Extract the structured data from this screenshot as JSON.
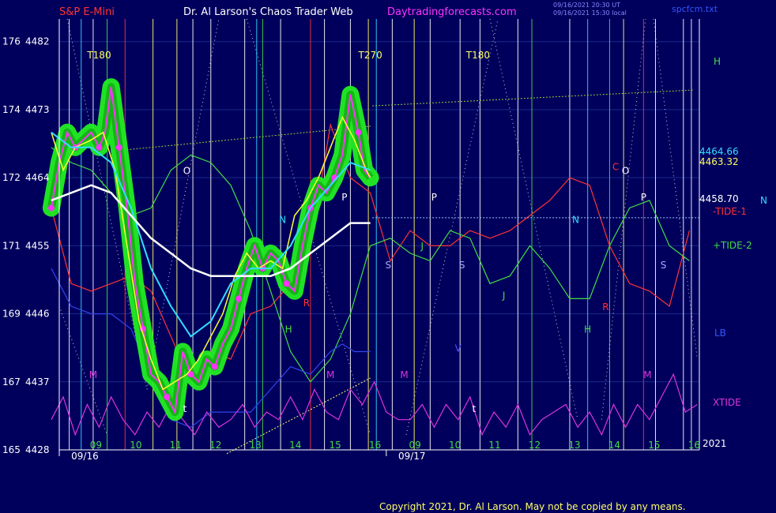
{
  "header": {
    "instrument": "S&P E-Mini",
    "title": "Dr. Al Larson's Chaos Trader Web",
    "site": "Daytradingforecasts.com",
    "stamp1": "09/16/2021 20:30 UT",
    "stamp2": "09/16/2021 15:30 local",
    "file": "spcfcm.txt",
    "copyright": "Copyright 2021, Dr. Al Larson. May not be copied by any means."
  },
  "colors": {
    "background": "#00005c",
    "price_bar": "#ff33ff",
    "price_glow": "#22ee22",
    "fast_ma": "#ffff33",
    "mid_ma": "#33ddff",
    "slow_ma": "#ffffff",
    "tide1": "#ff3333",
    "tide2": "#44dd44",
    "xtide": "#dd33dd",
    "lb": "#3344ee",
    "helio": "#ffcc44"
  },
  "chart_data": {
    "type": "line",
    "title": "S&P E-Mini",
    "ylabel_left_pairs": [
      {
        "a": "176",
        "b": "4482"
      },
      {
        "a": "174",
        "b": "4473"
      },
      {
        "a": "172",
        "b": "4464"
      },
      {
        "a": "171",
        "b": "4455"
      },
      {
        "a": "169",
        "b": "4446"
      },
      {
        "a": "167",
        "b": "4437"
      },
      {
        "a": "165",
        "b": "4428"
      }
    ],
    "ylim": [
      4428,
      4485
    ],
    "xlim": [
      8.2,
      24.25
    ],
    "x_hour_labels": [
      {
        "x": 9,
        "label": "09"
      },
      {
        "x": 10,
        "label": "10"
      },
      {
        "x": 11,
        "label": "11"
      },
      {
        "x": 12,
        "label": "12"
      },
      {
        "x": 13,
        "label": "13"
      },
      {
        "x": 14,
        "label": "14"
      },
      {
        "x": 15,
        "label": "15"
      },
      {
        "x": 16,
        "label": "16"
      },
      {
        "x": 17,
        "label": "09"
      },
      {
        "x": 18,
        "label": "10"
      },
      {
        "x": 19,
        "label": "11"
      },
      {
        "x": 20,
        "label": "12"
      },
      {
        "x": 21,
        "label": "13"
      },
      {
        "x": 22,
        "label": "14"
      },
      {
        "x": 23,
        "label": "15"
      },
      {
        "x": 24,
        "label": "16"
      }
    ],
    "date_labels": [
      {
        "x": 8.5,
        "label": "09/16"
      },
      {
        "x": 16.7,
        "label": "09/17"
      }
    ],
    "year_label": "2021",
    "right_levels": [
      {
        "y": 4464.66,
        "label": "4464.66"
      },
      {
        "y": 4463.32,
        "label": "4463.32"
      },
      {
        "y": 4458.7,
        "label": "4458.70"
      }
    ],
    "right_series_labels": [
      "H",
      "-TIDE-1",
      "+TIDE-2",
      "LB",
      "XTIDE",
      "N"
    ],
    "top_markers": [
      {
        "x": 9.2,
        "label": "T180"
      },
      {
        "x": 16.0,
        "label": "T270"
      },
      {
        "x": 18.7,
        "label": "T180"
      }
    ],
    "price": {
      "x": [
        8.0,
        8.2,
        8.4,
        8.6,
        8.8,
        9.0,
        9.2,
        9.35,
        9.5,
        9.7,
        9.9,
        10.1,
        10.3,
        10.5,
        10.7,
        10.9,
        11.1,
        11.3,
        11.5,
        11.7,
        11.9,
        12.1,
        12.3,
        12.5,
        12.7,
        12.9,
        13.1,
        13.3,
        13.5,
        13.7,
        13.9,
        14.1,
        14.3,
        14.5,
        14.7,
        14.9,
        15.1,
        15.3,
        15.5,
        15.7,
        15.85,
        16.0
      ],
      "y": [
        4460,
        4466,
        4470,
        4468,
        4469,
        4470,
        4468,
        4470,
        4476,
        4468,
        4460,
        4450,
        4444,
        4438,
        4437,
        4435,
        4433,
        4441,
        4438,
        4437,
        4440,
        4439,
        4442,
        4444,
        4448,
        4452,
        4455,
        4452,
        4454,
        4453,
        4450,
        4449,
        4455,
        4460,
        4463,
        4462,
        4464,
        4467,
        4475,
        4470,
        4465,
        4464
      ]
    },
    "series": [
      {
        "name": "-TIDE-1",
        "x": [
          8.0,
          8.5,
          9.0,
          9.5,
          10.0,
          10.5,
          11.0,
          11.5,
          12.0,
          12.5,
          13.0,
          13.5,
          14.0,
          14.5,
          15.0,
          15.5,
          16.0,
          16.5,
          17.0,
          17.5,
          18.0,
          18.5,
          19.0,
          19.5,
          20.0,
          20.5,
          21.0,
          21.5,
          22.0,
          22.5,
          23.0,
          23.5,
          24.0
        ],
        "y": [
          4460,
          4450,
          4449,
          4450,
          4451,
          4449,
          4443,
          4437,
          4441,
          4440,
          4446,
          4447,
          4450,
          4455,
          4471,
          4464,
          4462,
          4453,
          4457,
          4455,
          4455,
          4457,
          4456,
          4457,
          4459,
          4461,
          4464,
          4463,
          4455,
          4450,
          4449,
          4447,
          4457
        ]
      },
      {
        "name": "+TIDE-2",
        "x": [
          8.0,
          8.5,
          9.0,
          9.5,
          10.0,
          10.5,
          11.0,
          11.5,
          12.0,
          12.5,
          13.0,
          13.5,
          14.0,
          14.5,
          15.0,
          15.5,
          16.0,
          16.5,
          17.0,
          17.5,
          18.0,
          18.5,
          19.0,
          19.5,
          20.0,
          20.5,
          21.0,
          21.5,
          22.0,
          22.5,
          23.0,
          23.5,
          24.0
        ],
        "y": [
          4468,
          4466,
          4465,
          4462,
          4459,
          4460,
          4465,
          4467,
          4466,
          4463,
          4457,
          4449,
          4441,
          4437,
          4440,
          4446,
          4455,
          4456,
          4454,
          4453,
          4457,
          4456,
          4450,
          4451,
          4455,
          4452,
          4448,
          4448,
          4455,
          4460,
          4461,
          4455,
          4453
        ]
      },
      {
        "name": "LB",
        "x": [
          8.0,
          8.5,
          9.0,
          9.5,
          10.0,
          10.5,
          11.0,
          11.5,
          12.0,
          12.5,
          13.0,
          13.5,
          14.0,
          14.5,
          15.0,
          15.3,
          15.6,
          16.0
        ],
        "y": [
          4452,
          4447,
          4446,
          4446,
          4444,
          4438,
          4432,
          4431,
          4433,
          4433,
          4433,
          4436,
          4439,
          4438,
          4441,
          4442,
          4441,
          4441
        ]
      },
      {
        "name": "XTIDE",
        "x": [
          8.0,
          8.3,
          8.6,
          8.9,
          9.2,
          9.5,
          9.8,
          10.1,
          10.4,
          10.7,
          11.0,
          11.3,
          11.6,
          11.9,
          12.2,
          12.5,
          12.8,
          13.1,
          13.4,
          13.7,
          14.0,
          14.3,
          14.6,
          14.9,
          15.2,
          15.5,
          15.8,
          16.1,
          16.4,
          16.7,
          17.0,
          17.3,
          17.6,
          17.9,
          18.2,
          18.5,
          18.8,
          19.1,
          19.4,
          19.7,
          20.0,
          20.3,
          20.6,
          20.9,
          21.2,
          21.5,
          21.8,
          22.1,
          22.4,
          22.7,
          23.0,
          23.3,
          23.6,
          23.9,
          24.2
        ],
        "y": [
          4432,
          4435,
          4430,
          4434,
          4431,
          4435,
          4432,
          4430,
          4433,
          4431,
          4434,
          4432,
          4430,
          4433,
          4431,
          4432,
          4434,
          4431,
          4433,
          4432,
          4435,
          4432,
          4436,
          4433,
          4432,
          4436,
          4434,
          4437,
          4433,
          4432,
          4432,
          4434,
          4431,
          4434,
          4432,
          4435,
          4430,
          4433,
          4431,
          4434,
          4430,
          4432,
          4433,
          4434,
          4431,
          4433,
          4430,
          4434,
          4431,
          4434,
          4432,
          4435,
          4438,
          4433,
          4434
        ]
      }
    ],
    "moving_averages": [
      {
        "name": "fast",
        "x": [
          8.0,
          8.3,
          8.6,
          9.0,
          9.3,
          9.6,
          9.9,
          10.2,
          10.5,
          10.8,
          11.1,
          11.4,
          11.7,
          12.0,
          12.3,
          12.6,
          12.9,
          13.2,
          13.5,
          13.8,
          14.1,
          14.4,
          14.7,
          15.0,
          15.3,
          15.6,
          15.9,
          16.0
        ],
        "y": [
          4470,
          4465,
          4468,
          4469,
          4470,
          4465,
          4455,
          4445,
          4440,
          4436,
          4437,
          4438,
          4440,
          4443,
          4446,
          4451,
          4454,
          4452,
          4453,
          4452,
          4459,
          4461,
          4464,
          4468,
          4472,
          4469,
          4465,
          4464
        ]
      },
      {
        "name": "mid",
        "x": [
          8.0,
          8.5,
          9.0,
          9.5,
          10.0,
          10.5,
          11.0,
          11.5,
          12.0,
          12.5,
          13.0,
          13.5,
          14.0,
          14.5,
          15.0,
          15.5,
          16.0
        ],
        "y": [
          4470,
          4468,
          4468,
          4466,
          4460,
          4452,
          4447,
          4443,
          4445,
          4450,
          4452,
          4452,
          4455,
          4460,
          4463,
          4466,
          4465
        ]
      },
      {
        "name": "slow",
        "x": [
          8.0,
          8.5,
          9.0,
          9.5,
          10.0,
          10.5,
          11.0,
          11.5,
          12.0,
          12.5,
          13.0,
          13.5,
          14.0,
          14.5,
          15.0,
          15.5,
          16.0
        ],
        "y": [
          4461,
          4462,
          4463,
          4462,
          4459,
          4456,
          4454,
          4452,
          4451,
          4451,
          4451,
          4451,
          4452,
          4454,
          4456,
          4458,
          4458
        ]
      }
    ],
    "vertical_lines": [
      {
        "x": 8.45,
        "color": "#ffffff"
      },
      {
        "x": 8.75,
        "color": "#33ddff"
      },
      {
        "x": 9.05,
        "color": "#ffffff"
      },
      {
        "x": 9.4,
        "color": "#44dd44"
      },
      {
        "x": 9.85,
        "color": "#ff3333"
      },
      {
        "x": 10.55,
        "color": "#ffff66"
      },
      {
        "x": 11.15,
        "color": "#ffff66"
      },
      {
        "x": 11.55,
        "color": "#ffffff"
      },
      {
        "x": 12.0,
        "color": "#ffffff"
      },
      {
        "x": 12.85,
        "color": "#ffffff"
      },
      {
        "x": 13.15,
        "color": "#33ddff"
      },
      {
        "x": 13.3,
        "color": "#44dd44"
      },
      {
        "x": 13.75,
        "color": "#ffffff"
      },
      {
        "x": 14.5,
        "color": "#ff3333"
      },
      {
        "x": 14.85,
        "color": "#ffffff"
      },
      {
        "x": 15.5,
        "color": "#ffffff"
      },
      {
        "x": 15.95,
        "color": "#ffff66"
      },
      {
        "x": 16.15,
        "color": "#33ddff"
      },
      {
        "x": 16.55,
        "color": "#ffffff"
      },
      {
        "x": 17.1,
        "color": "#ffff66"
      },
      {
        "x": 17.5,
        "color": "#ffffff"
      },
      {
        "x": 18.25,
        "color": "#ffffff"
      },
      {
        "x": 18.75,
        "color": "#ffffff"
      },
      {
        "x": 19.7,
        "color": "#ffffff"
      },
      {
        "x": 20.05,
        "color": "#44dd44"
      },
      {
        "x": 21.0,
        "color": "#ffffff"
      },
      {
        "x": 21.45,
        "color": "#33ddff"
      },
      {
        "x": 22.0,
        "color": "#44dd44"
      },
      {
        "x": 22.35,
        "color": "#ffff66"
      },
      {
        "x": 22.85,
        "color": "#ff3333"
      },
      {
        "x": 23.15,
        "color": "#ffffff"
      },
      {
        "x": 23.85,
        "color": "#ffffff"
      },
      {
        "x": 24.05,
        "color": "#ffffff"
      }
    ],
    "annotations": [
      {
        "x": 11.4,
        "y": 4464.5,
        "text": "O",
        "color": "#ffffff"
      },
      {
        "x": 22.4,
        "y": 4464.5,
        "text": "O",
        "color": "#ffffff"
      },
      {
        "x": 17.6,
        "y": 4461.0,
        "text": "P",
        "color": "#ffffff"
      },
      {
        "x": 15.35,
        "y": 4461.0,
        "text": "P",
        "color": "#ffffff"
      },
      {
        "x": 22.85,
        "y": 4461.0,
        "text": "P",
        "color": "#ffffff"
      },
      {
        "x": 13.8,
        "y": 4458.0,
        "text": "N",
        "color": "#33ddff"
      },
      {
        "x": 21.15,
        "y": 4458.0,
        "text": "N",
        "color": "#33ddff"
      },
      {
        "x": 16.45,
        "y": 4452.0,
        "text": "S",
        "color": "#aaaaff"
      },
      {
        "x": 18.3,
        "y": 4452.0,
        "text": "S",
        "color": "#aaaaff"
      },
      {
        "x": 23.35,
        "y": 4452.0,
        "text": "S",
        "color": "#aaaaff"
      },
      {
        "x": 13.95,
        "y": 4443.5,
        "text": "H",
        "color": "#44dd44"
      },
      {
        "x": 21.45,
        "y": 4443.5,
        "text": "H",
        "color": "#44dd44"
      },
      {
        "x": 22.15,
        "y": 4465.0,
        "text": "C",
        "color": "#ff3333"
      },
      {
        "x": 19.35,
        "y": 4448.0,
        "text": "J",
        "color": "#44dd44"
      },
      {
        "x": 17.3,
        "y": 4454.5,
        "text": "J",
        "color": "#44dd44"
      },
      {
        "x": 14.4,
        "y": 4447.0,
        "text": "R",
        "color": "#ff3333"
      },
      {
        "x": 21.9,
        "y": 4446.5,
        "text": "R",
        "color": "#ff3333"
      },
      {
        "x": 18.2,
        "y": 4441.0,
        "text": "V",
        "color": "#5555ff"
      },
      {
        "x": 9.05,
        "y": 4437.5,
        "text": "M",
        "color": "#dd33dd"
      },
      {
        "x": 15.0,
        "y": 4437.5,
        "text": "M",
        "color": "#dd33dd"
      },
      {
        "x": 16.85,
        "y": 4437.5,
        "text": "M",
        "color": "#dd33dd"
      },
      {
        "x": 22.95,
        "y": 4437.5,
        "text": "M",
        "color": "#dd33dd"
      },
      {
        "x": 11.35,
        "y": 4433.0,
        "text": "t",
        "color": "#ffffff"
      },
      {
        "x": 18.6,
        "y": 4433.0,
        "text": "t",
        "color": "#ffffff"
      }
    ],
    "trendlines": [
      {
        "x": [
          16.05,
          24.1
        ],
        "y": [
          4473.5,
          4475.6
        ],
        "color": "#99cc33"
      },
      {
        "x": [
          9.5,
          16.0
        ],
        "y": [
          4467.5,
          4470.8
        ],
        "color": "#99cc33"
      },
      {
        "x": [
          12.4,
          16.0
        ],
        "y": [
          4427.5,
          4437.5
        ],
        "color": "#ffff66"
      }
    ],
    "grid": true,
    "legend": "right"
  }
}
